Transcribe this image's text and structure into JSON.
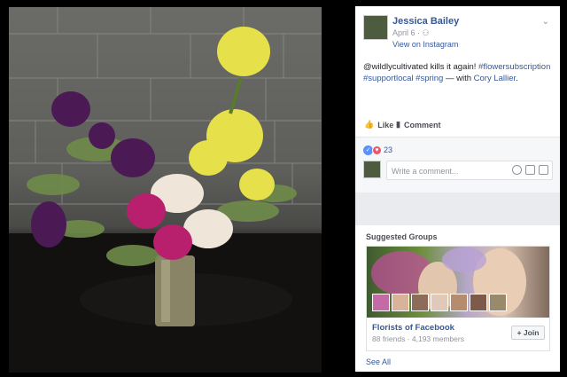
{
  "post": {
    "author": "Jessica Bailey",
    "date": "April 6",
    "audience_icon": "friends-icon",
    "view_link": "View on Instagram",
    "caption_prefix": "@wildlycultivated kills it again! ",
    "tag1": "#flowersubscription",
    "tag2": "#supportlocal",
    "tag3": "#spring",
    "with_text": " — with ",
    "with_person": "Cory Lallier",
    "period": "."
  },
  "actions": {
    "like_label": "Like",
    "comment_label": "Comment"
  },
  "reactions": {
    "count": "23"
  },
  "comment_box": {
    "placeholder": "Write a comment..."
  },
  "suggested": {
    "title": "Suggested Groups",
    "group_name": "Florists of Facebook",
    "group_stats": "88 friends · 4,193 members",
    "join_label": "+ Join",
    "see_all": "See All"
  },
  "colors": {
    "link": "#365899",
    "text": "#1d2129",
    "muted": "#90949c",
    "like_blue": "#5890ff",
    "love_red": "#f25268"
  }
}
